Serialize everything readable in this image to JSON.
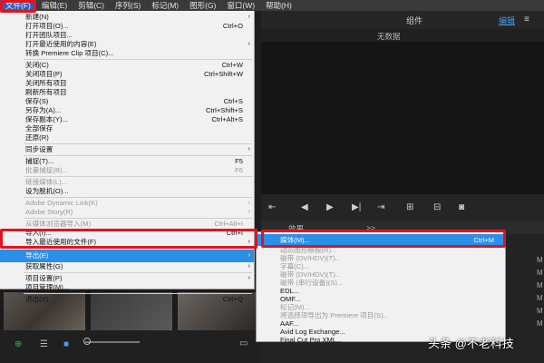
{
  "menubar": [
    {
      "id": "file",
      "label": "文件(F)"
    },
    {
      "id": "edit",
      "label": "编辑(E)"
    },
    {
      "id": "clip",
      "label": "剪辑(C)"
    },
    {
      "id": "sequence",
      "label": "序列(S)"
    },
    {
      "id": "marker",
      "label": "标记(M)"
    },
    {
      "id": "graphics",
      "label": "图形(G)"
    },
    {
      "id": "window",
      "label": "窗口(W)"
    },
    {
      "id": "help",
      "label": "帮助(H)"
    }
  ],
  "header": {
    "workspace": "组件",
    "edit": "编辑",
    "program_title": "无数据"
  },
  "timeline": {
    "tab_effects": "效果",
    "tab_more": ">>"
  },
  "file_menu": {
    "items": [
      {
        "label": "新建(N)",
        "shortcut": "",
        "arrow": true,
        "disabled": false
      },
      {
        "label": "打开项目(O)...",
        "shortcut": "Ctrl+O",
        "disabled": false
      },
      {
        "label": "打开团队项目...",
        "shortcut": "",
        "disabled": false
      },
      {
        "label": "打开最近使用的内容(E)",
        "shortcut": "",
        "arrow": true,
        "disabled": false
      },
      {
        "label": "转换 Premiere Clip 项目(C)...",
        "shortcut": "",
        "disabled": false
      },
      {
        "label": "关闭(C)",
        "shortcut": "Ctrl+W",
        "disabled": false,
        "sep_before": true
      },
      {
        "label": "关闭项目(P)",
        "shortcut": "Ctrl+Shift+W",
        "disabled": false
      },
      {
        "label": "关闭所有项目",
        "shortcut": "",
        "disabled": false
      },
      {
        "label": "刷新所有项目",
        "shortcut": "",
        "disabled": false
      },
      {
        "label": "保存(S)",
        "shortcut": "Ctrl+S",
        "disabled": false
      },
      {
        "label": "另存为(A)...",
        "shortcut": "Ctrl+Shift+S",
        "disabled": false
      },
      {
        "label": "保存副本(Y)...",
        "shortcut": "Ctrl+Alt+S",
        "disabled": false
      },
      {
        "label": "全部保存",
        "shortcut": "",
        "disabled": false
      },
      {
        "label": "还原(R)",
        "shortcut": "",
        "disabled": false
      },
      {
        "label": "同步设置",
        "shortcut": "",
        "arrow": true,
        "disabled": false,
        "sep_before": true
      },
      {
        "label": "捕捉(T)...",
        "shortcut": "F5",
        "disabled": false,
        "sep_before": true
      },
      {
        "label": "批量捕捉(B)...",
        "shortcut": "F6",
        "disabled": true
      },
      {
        "label": "链接媒体(L)...",
        "shortcut": "",
        "disabled": true,
        "sep_before": true
      },
      {
        "label": "设为脱机(O)...",
        "shortcut": "",
        "disabled": false
      },
      {
        "label": "Adobe Dynamic Link(K)",
        "shortcut": "",
        "arrow": true,
        "disabled": true,
        "sep_before": true
      },
      {
        "label": "Adobe Story(R)",
        "shortcut": "",
        "arrow": true,
        "disabled": true
      },
      {
        "label": "从媒体浏览器导入(M)",
        "shortcut": "Ctrl+Alt+I",
        "disabled": true,
        "sep_before": true
      },
      {
        "label": "导入(I)...",
        "shortcut": "Ctrl+I",
        "disabled": false
      },
      {
        "label": "导入最近使用的文件(F)",
        "shortcut": "",
        "arrow": true,
        "disabled": false
      },
      {
        "label": "导出(E)",
        "shortcut": "",
        "arrow": true,
        "disabled": false,
        "selected": true,
        "sep_before": true
      },
      {
        "label": "获取属性(G)",
        "shortcut": "",
        "arrow": true,
        "disabled": false
      },
      {
        "label": "项目设置(P)",
        "shortcut": "",
        "arrow": true,
        "disabled": false,
        "sep_before": true
      },
      {
        "label": "项目管理(M)...",
        "shortcut": "",
        "disabled": false
      },
      {
        "label": "退出(X)",
        "shortcut": "Ctrl+Q",
        "disabled": false,
        "sep_before": true
      }
    ]
  },
  "export_menu": {
    "items": [
      {
        "label": "媒体(M)...",
        "shortcut": "Ctrl+M",
        "disabled": false,
        "selected": true
      },
      {
        "label": "动态图形模板(R)...",
        "shortcut": "",
        "disabled": true
      },
      {
        "label": "磁带 (DV/HDV)(T)...",
        "shortcut": "",
        "disabled": true
      },
      {
        "label": "字幕(C)...",
        "shortcut": "",
        "disabled": true
      },
      {
        "label": "磁带 (DV/HDV)(T)...",
        "shortcut": "",
        "disabled": true
      },
      {
        "label": "磁带 (串行设备)(S)...",
        "shortcut": "",
        "disabled": true
      },
      {
        "label": "EDL...",
        "shortcut": "",
        "disabled": false
      },
      {
        "label": "OMF...",
        "shortcut": "",
        "disabled": false
      },
      {
        "label": "标记(M)...",
        "shortcut": "",
        "disabled": true
      },
      {
        "label": "将选择项导出为 Premiere 项目(S)...",
        "shortcut": "",
        "disabled": true
      },
      {
        "label": "AAF...",
        "shortcut": "",
        "disabled": false
      },
      {
        "label": "Avid Log Exchange...",
        "shortcut": "",
        "disabled": false
      },
      {
        "label": "Final Cut Pro XML...",
        "shortcut": "",
        "disabled": false
      }
    ]
  },
  "track_labels": [
    "M",
    "M",
    "M",
    "M",
    "M",
    "M"
  ],
  "watermark": "头条 @不老科技",
  "colors": {
    "highlight": "#2a8fe6",
    "annotation_red": "#e0141e"
  }
}
